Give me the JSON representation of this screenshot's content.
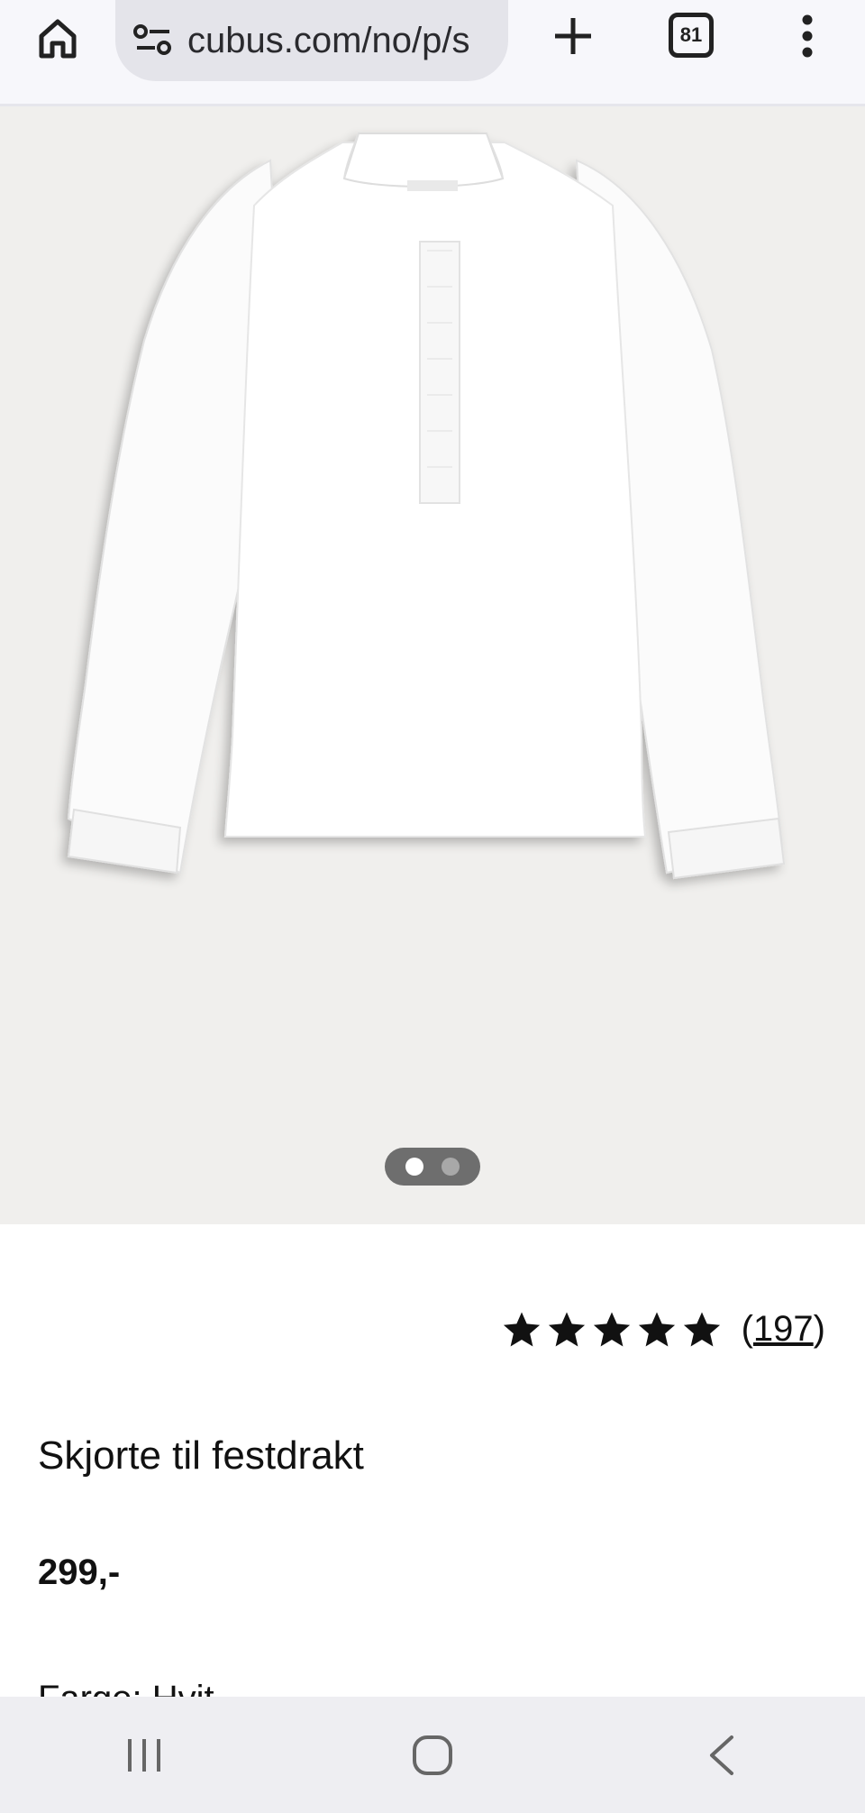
{
  "browser": {
    "url": "cubus.com/no/p/s",
    "tab_count": "81"
  },
  "gallery": {
    "image_alt": "Skjorte til festdrakt",
    "pages": 2,
    "active_page": 1
  },
  "product": {
    "rating_stars": 5,
    "rating_open": "(",
    "rating_count": "197",
    "rating_close": ")",
    "title": "Skjorte til festdrakt",
    "price": "299,-",
    "color_label": "Farge: Hvit"
  },
  "colors": {
    "toolbar_bg": "#f7f7fb",
    "image_bg": "#f0efed",
    "text": "#111111",
    "navbar_bg": "#eeeef2"
  }
}
